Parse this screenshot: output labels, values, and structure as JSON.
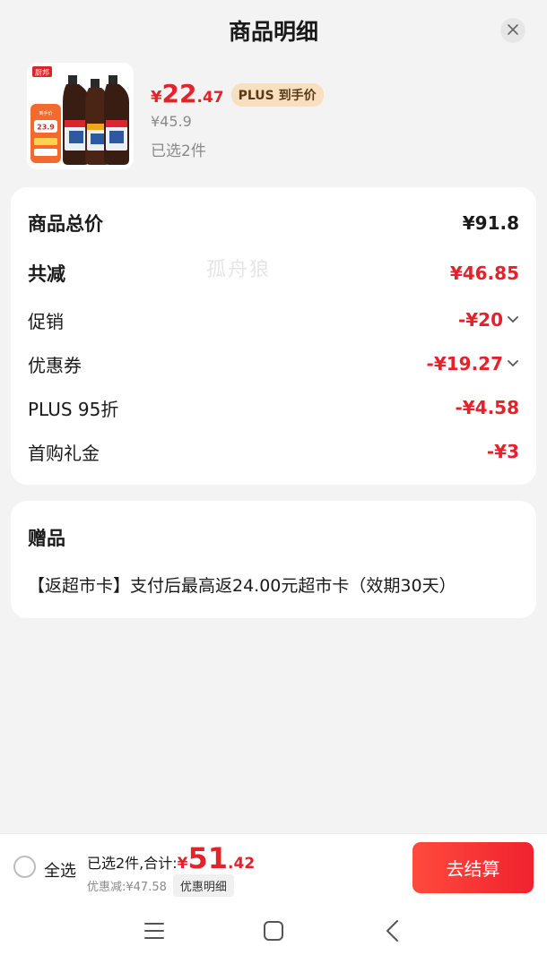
{
  "header": {
    "title": "商品明细"
  },
  "product": {
    "yen": "¥",
    "price_int": "22",
    "price_dec": ".47",
    "plus_badge": "PLUS 到手价",
    "original_price": "¥45.9",
    "selected": "已选2件",
    "thumb": {
      "brand": "厨邦",
      "promo_label": "到手价",
      "promo_price": "23.9"
    }
  },
  "totals": {
    "goods_total_label": "商品总价",
    "goods_total_value": "¥91.8",
    "total_reduction_label": "共减",
    "total_reduction_value": "¥46.85",
    "rows": [
      {
        "label": "促销",
        "value": "-¥20"
      },
      {
        "label": "优惠券",
        "value": "-¥19.27"
      },
      {
        "label": "PLUS 95折",
        "value": "-¥4.58"
      },
      {
        "label": "首购礼金",
        "value": "-¥3"
      }
    ],
    "watermark": "孤舟狼"
  },
  "gift": {
    "title": "赠品",
    "description": "【返超市卡】支付后最高返24.00元超市卡（效期30天）"
  },
  "bottom_bar": {
    "select_all": "全选",
    "summary_prefix": "已选2件,合计:",
    "yen": "¥",
    "total_int": "51",
    "total_dec": ".42",
    "discount_text": "优惠减:¥47.58",
    "detail_button": "优惠明细",
    "checkout_button": "去结算"
  },
  "colors": {
    "accent_red": "#e3222b",
    "plus_badge_bg": "#f7dfc0",
    "page_bg": "#f3f3f3"
  },
  "icons": {
    "close": "close-icon",
    "chevron": "chevron-down-icon",
    "nav_menu": "menu-icon",
    "nav_home": "home-icon",
    "nav_back": "back-icon"
  }
}
